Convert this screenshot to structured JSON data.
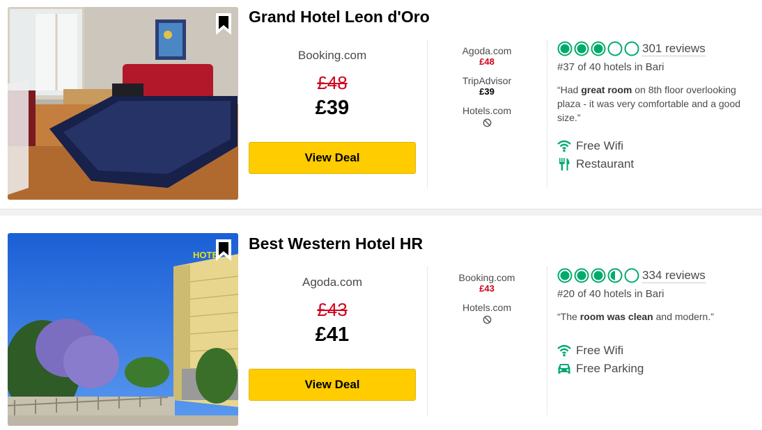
{
  "hotels": [
    {
      "name": "Grand Hotel Leon d'Oro",
      "main_provider": "Booking.com",
      "old_price": "£48",
      "price": "£39",
      "deal_label": "View Deal",
      "other_offers": [
        {
          "provider": "Agoda.com",
          "price": "£48",
          "price_color": "red"
        },
        {
          "provider": "TripAdvisor",
          "price": "£39",
          "price_color": "black"
        },
        {
          "provider": "Hotels.com",
          "price": null,
          "unavailable_icon": "not-available-icon"
        }
      ],
      "rating_bubbles": 3,
      "reviews": "301 reviews",
      "rank": "#37 of 40 hotels in Bari",
      "quote_parts": [
        "“Had ",
        "great room",
        " on 8th floor overlooking plaza - it was very comfortable and a good size.”"
      ],
      "amenities": [
        {
          "icon": "wifi-icon",
          "label": "Free Wifi"
        },
        {
          "icon": "restaurant-icon",
          "label": "Restaurant"
        }
      ]
    },
    {
      "name": "Best Western Hotel HR",
      "main_provider": "Agoda.com",
      "old_price": "£43",
      "price": "£41",
      "deal_label": "View Deal",
      "other_offers": [
        {
          "provider": "Booking.com",
          "price": "£43",
          "price_color": "red"
        },
        {
          "provider": "Hotels.com",
          "price": null,
          "unavailable_icon": "not-available-icon"
        }
      ],
      "rating_bubbles": 3.5,
      "reviews": "334 reviews",
      "rank": "#20 of 40 hotels in Bari",
      "quote_parts": [
        "“The ",
        "room was clean",
        " and modern.”"
      ],
      "amenities": [
        {
          "icon": "wifi-icon",
          "label": "Free Wifi"
        },
        {
          "icon": "car-icon",
          "label": "Free Parking"
        }
      ]
    }
  ],
  "photo_sign_text": "HOTE",
  "colors": {
    "accent_green": "#00aa6c",
    "deal_yellow": "#ffcc00",
    "price_red": "#d0021b"
  }
}
